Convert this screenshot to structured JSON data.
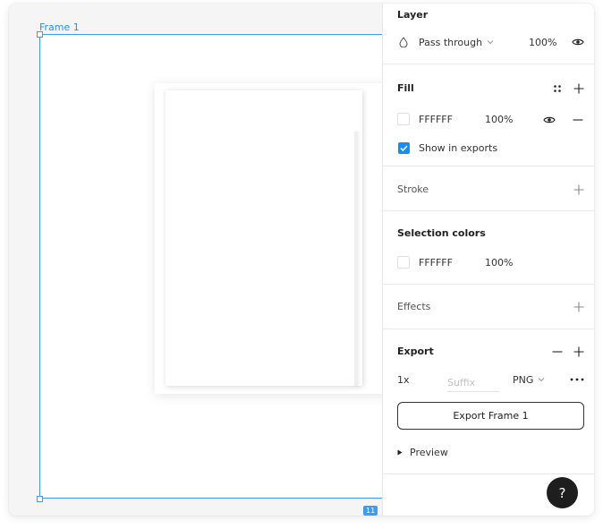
{
  "canvas": {
    "frame_label": "Frame 1",
    "size_tag": "11"
  },
  "layer": {
    "title": "Layer",
    "blend_mode": "Pass through",
    "opacity": "100%"
  },
  "fill": {
    "title": "Fill",
    "hex": "FFFFFF",
    "opacity": "100%",
    "show_in_exports_label": "Show in exports",
    "show_in_exports_checked": true
  },
  "stroke": {
    "title": "Stroke"
  },
  "selection_colors": {
    "title": "Selection colors",
    "hex": "FFFFFF",
    "opacity": "100%"
  },
  "effects": {
    "title": "Effects"
  },
  "export": {
    "title": "Export",
    "scale": "1x",
    "suffix_placeholder": "Suffix",
    "format": "PNG",
    "button_label": "Export Frame 1",
    "preview_label": "Preview"
  },
  "help": {
    "label": "?"
  },
  "colors": {
    "selection_blue": "#3d9bf0",
    "checkbox_blue": "#1b8cf0",
    "help_bg": "#1e1e1e"
  }
}
